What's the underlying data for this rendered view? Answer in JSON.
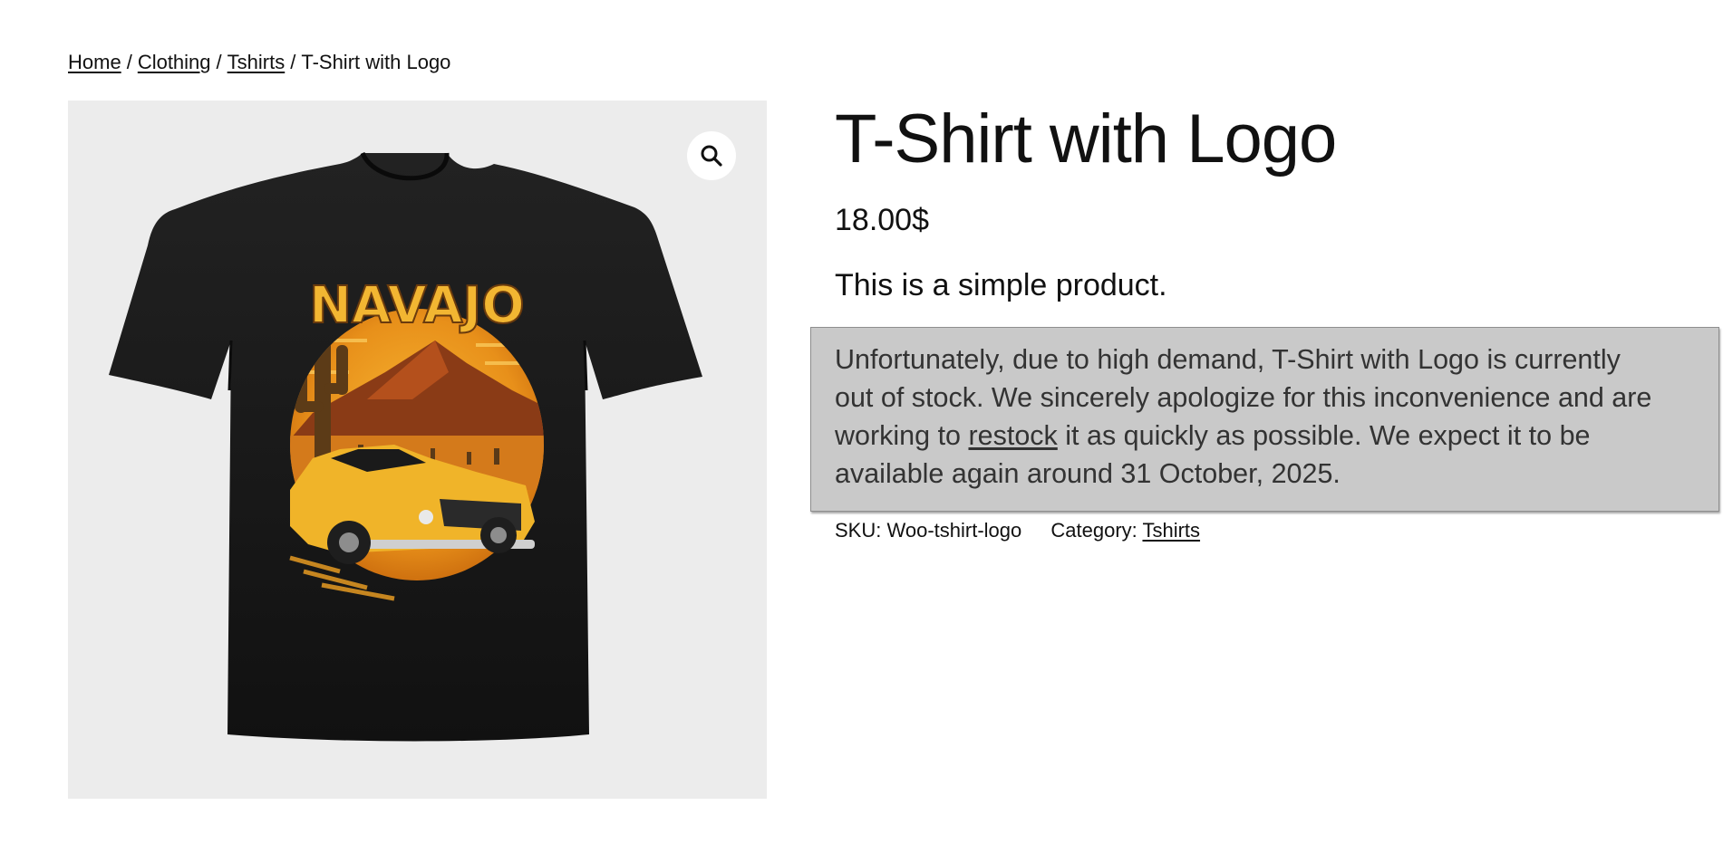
{
  "breadcrumb": {
    "home": "Home",
    "clothing": "Clothing",
    "tshirts": "Tshirts",
    "current": "T-Shirt with Logo",
    "separator": "/"
  },
  "gallery": {
    "zoom_icon": "search-icon",
    "image_alt": "T-Shirt with Logo",
    "print_text": "NAVAJO",
    "background_color": "#ececec"
  },
  "product": {
    "title": "T-Shirt with Logo",
    "price": "18.00$",
    "short_description": "This is a simple product."
  },
  "stock_notice": {
    "text_before_link": "Unfortunately, due to high demand, T-Shirt with Logo is currently out of stock. We sincerely apologize for this inconvenience and are working to ",
    "link_text": "restock",
    "text_after_link": " it as quickly as possible. We expect it to be available again around 31 October, 2025.",
    "background_color": "#c9c9c9"
  },
  "meta": {
    "sku_label": "SKU:",
    "sku_value": "Woo-tshirt-logo",
    "category_label": "Category:",
    "category_value": "Tshirts"
  }
}
